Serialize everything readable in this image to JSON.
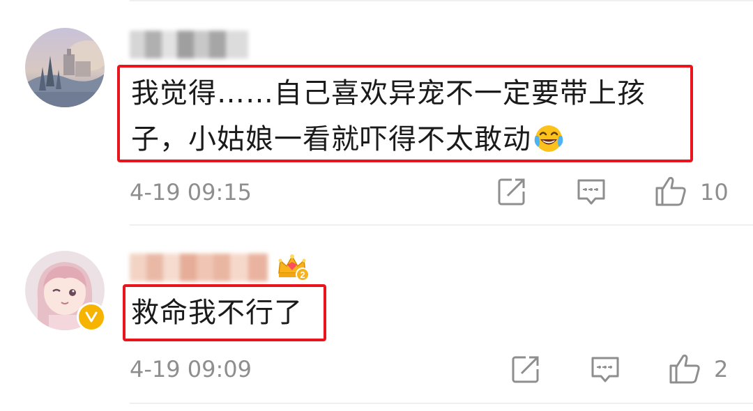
{
  "comments": [
    {
      "text": "我觉得……自己喜欢异宠不一定要带上孩子，小姑娘一看就吓得不太敢动",
      "emoji": "laughing-tears",
      "timestamp": "4-19 09:15",
      "like_count": "10"
    },
    {
      "text": "救命我不行了",
      "timestamp": "4-19 09:09",
      "like_count": "2",
      "badge": "2"
    }
  ],
  "colors": {
    "highlight_border": "#e8161c",
    "meta_text": "#8e8e8e",
    "verified": "#f6b400"
  }
}
